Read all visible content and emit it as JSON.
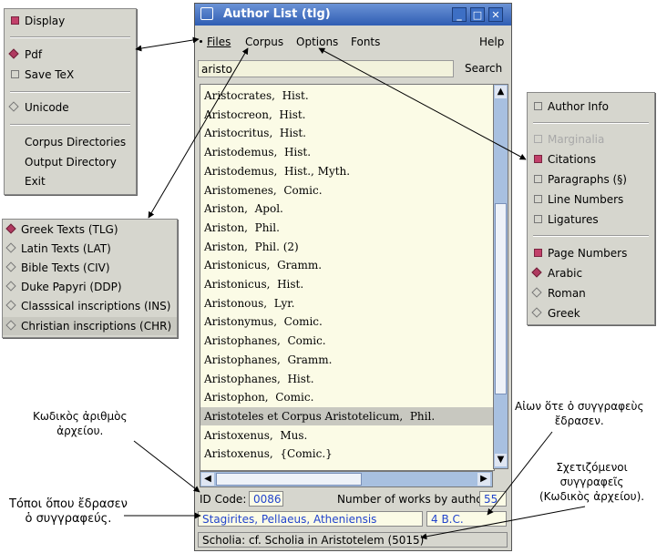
{
  "files_menu": {
    "items": [
      {
        "label": "Display",
        "kind": "check",
        "checked": true
      },
      {
        "label": "Pdf",
        "kind": "radio",
        "checked": true
      },
      {
        "label": "Save TeX",
        "kind": "check",
        "checked": false
      },
      {
        "label": "Unicode",
        "kind": "radio",
        "checked": false
      },
      {
        "label": "Corpus Directories",
        "kind": "plain"
      },
      {
        "label": "Output Directory",
        "kind": "plain"
      },
      {
        "label": "Exit",
        "kind": "plain"
      }
    ]
  },
  "corpus_menu": {
    "items": [
      {
        "label": "Greek Texts  (TLG)",
        "checked": true
      },
      {
        "label": "Latin Texts  (LAT)",
        "checked": false
      },
      {
        "label": "Bible Texts  (CIV)",
        "checked": false
      },
      {
        "label": "Duke Papyri  (DDP)",
        "checked": false
      },
      {
        "label": "Classsical inscriptions (INS)",
        "checked": false
      },
      {
        "label": "Christian  inscriptions (CHR)",
        "checked": false
      }
    ]
  },
  "options_menu": {
    "items": [
      {
        "label": "Author Info",
        "kind": "check",
        "checked": false,
        "disabled": false
      },
      {
        "label": "Marginalia",
        "kind": "check",
        "checked": false,
        "disabled": true
      },
      {
        "label": "Citations",
        "kind": "check",
        "checked": true,
        "disabled": false
      },
      {
        "label": "Paragraphs (§)",
        "kind": "check",
        "checked": false,
        "disabled": false
      },
      {
        "label": "Line Numbers",
        "kind": "check",
        "checked": false,
        "disabled": false
      },
      {
        "label": "Ligatures",
        "kind": "check",
        "checked": false,
        "disabled": false
      },
      {
        "label": "Page Numbers",
        "kind": "check",
        "checked": true,
        "disabled": false
      },
      {
        "label": "Arabic",
        "kind": "radio",
        "checked": true,
        "disabled": false
      },
      {
        "label": "Roman",
        "kind": "radio",
        "checked": false,
        "disabled": false
      },
      {
        "label": "Greek",
        "kind": "radio",
        "checked": false,
        "disabled": false
      }
    ]
  },
  "window": {
    "title": "Author List (tlg)",
    "menu": {
      "files": "Files",
      "corpus": "Corpus",
      "options": "Options",
      "fonts": "Fonts",
      "help": "Help"
    },
    "search_value": "aristo",
    "search_button": "Search",
    "authors": [
      "Aristocrates,  Hist.",
      "Aristocreon,  Hist.",
      "Aristocritus,  Hist.",
      "Aristodemus,  Hist.",
      "Aristodemus,  Hist., Myth.",
      "Aristomenes,  Comic.",
      "Ariston,  Apol.",
      "Ariston,  Phil.",
      "Ariston,  Phil. (2)",
      "Aristonicus,  Gramm.",
      "Aristonicus,  Hist.",
      "Aristonous,  Lyr.",
      "Aristonymus,  Comic.",
      "Aristophanes,  Comic.",
      "Aristophanes,  Gramm.",
      "Aristophanes,  Hist.",
      "Aristophon,  Comic.",
      "Aristoteles et Corpus Aristotelicum,  Phil.",
      "Aristoxenus,  Mus.",
      "Aristoxenus,  {Comic.}"
    ],
    "selected_index": 17,
    "id_code_label": "ID Code:",
    "id_code_value": "0086",
    "works_label": "Number of works by author:",
    "works_value": "55",
    "location": "Stagirites, Pellaeus, Atheniensis",
    "date": "4 B.C.",
    "scholia": "Scholia: cf. Scholia in Aristotelem (5015)"
  },
  "annotations": {
    "file_code": [
      "Κωδικὸς ἀριθμὸς",
      "ἀρχείου."
    ],
    "places": [
      "Τόποι ὅπου ἔδρασεν",
      "ὁ συγγραφεύς."
    ],
    "century": [
      "Αἰων ὅτε ὁ συγγραφεὺς",
      "ἔδρασεν."
    ],
    "related": [
      "Σχετιζόμενοι",
      "συγγραφεῖς",
      "(Κωδικὸς ἀρχείου)."
    ]
  },
  "colors": {
    "accent": "#c2406a",
    "titlebar": "#2f5db3",
    "link_text": "#2244cc",
    "list_bg": "#fbfbe6"
  }
}
